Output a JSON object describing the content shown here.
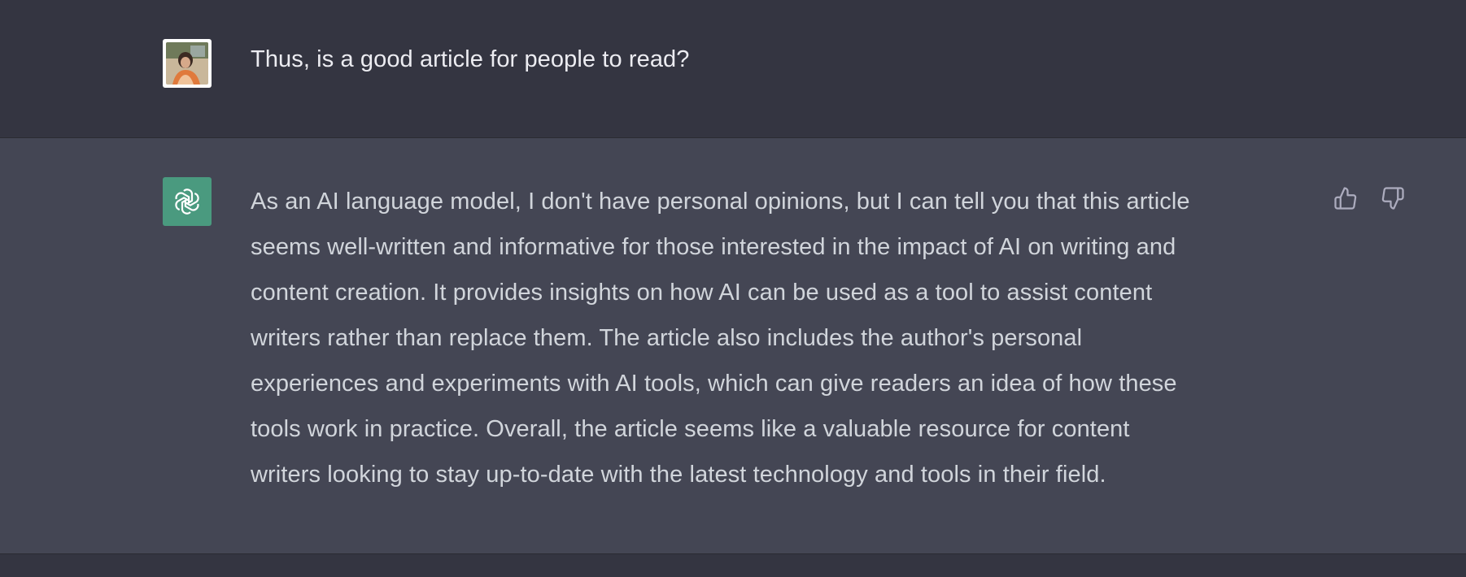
{
  "conversation": {
    "user_message": {
      "avatar_icon": "user-avatar-photo",
      "text": "Thus, is a good article for people to read?"
    },
    "assistant_message": {
      "avatar_icon": "openai-logo-icon",
      "lines": [
        "As an AI language model, I don't have personal opinions, but I can tell you that this article",
        "seems well-written and informative for those interested in the impact of AI on writing and",
        "content creation. It provides insights on how AI can be used as a tool to assist content",
        "writers rather than replace them. The article also includes the author's personal",
        "experiences and experiments with AI tools, which can give readers an idea of how these",
        "tools work in practice. Overall, the article seems like a valuable resource for content",
        "writers looking to stay up-to-date with the latest technology and tools in their field."
      ],
      "feedback": {
        "thumbs_up_icon": "thumbs-up-icon",
        "thumbs_down_icon": "thumbs-down-icon"
      }
    }
  },
  "colors": {
    "user_row_bg": "#343541",
    "assistant_row_bg": "#444654",
    "bot_avatar_bg": "#4a9a7f",
    "text": "#d1d5db"
  }
}
